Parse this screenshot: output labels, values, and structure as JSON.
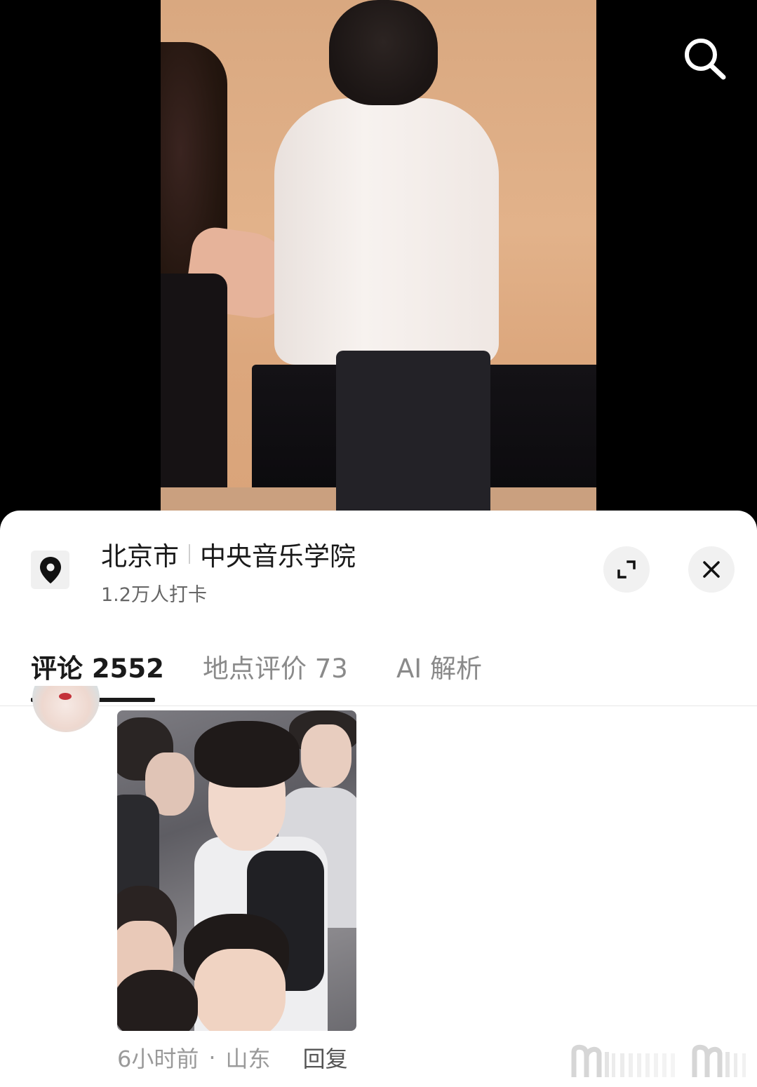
{
  "location": {
    "city": "北京市",
    "place": "中央音乐学院",
    "checkins": "1.2万人打卡"
  },
  "tabs": [
    {
      "label": "评论 2552",
      "active": true
    },
    {
      "label": "地点评价 73",
      "active": false
    },
    {
      "label": "AI 解析",
      "active": false
    }
  ],
  "comment": {
    "time": "6小时前",
    "separator": "·",
    "region": "山东",
    "reply_label": "回复"
  },
  "icons": {
    "search": "search-icon",
    "location": "location-pin-icon",
    "expand": "expand-icon",
    "close": "close-icon"
  },
  "colors": {
    "sheet_bg": "#ffffff",
    "text_primary": "#1a1a1a",
    "text_secondary": "#8a8a8a",
    "button_bg": "#f1f1f1"
  }
}
